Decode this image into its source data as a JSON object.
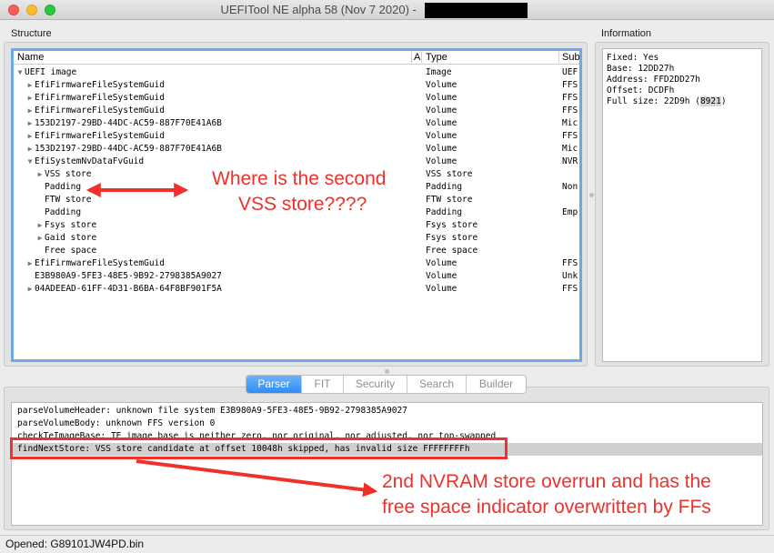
{
  "window": {
    "title": "UEFITool NE alpha 58 (Nov  7 2020) - "
  },
  "structure": {
    "label": "Structure",
    "columns": {
      "name": "Name",
      "action": "A",
      "type": "Type",
      "subtype": "Sub"
    },
    "rows": [
      {
        "name": "UEFI image",
        "type": "Image",
        "subtype": "UEF",
        "arrow": "▼"
      },
      {
        "name": "EfiFirmwareFileSystemGuid",
        "type": "Volume",
        "subtype": "FFS",
        "arrow": "▶"
      },
      {
        "name": "EfiFirmwareFileSystemGuid",
        "type": "Volume",
        "subtype": "FFS",
        "arrow": "▶"
      },
      {
        "name": "EfiFirmwareFileSystemGuid",
        "type": "Volume",
        "subtype": "FFS",
        "arrow": "▶"
      },
      {
        "name": "153D2197-29BD-44DC-AC59-887F70E41A6B",
        "type": "Volume",
        "subtype": "Mic",
        "arrow": "▶"
      },
      {
        "name": "EfiFirmwareFileSystemGuid",
        "type": "Volume",
        "subtype": "FFS",
        "arrow": "▶"
      },
      {
        "name": "153D2197-29BD-44DC-AC59-887F70E41A6B",
        "type": "Volume",
        "subtype": "Mic",
        "arrow": "▶"
      },
      {
        "name": "EfiSystemNvDataFvGuid",
        "type": "Volume",
        "subtype": "NVR",
        "arrow": "▼"
      },
      {
        "name": "VSS store",
        "type": "VSS store",
        "subtype": "",
        "arrow": "▶"
      },
      {
        "name": "Padding",
        "type": "Padding",
        "subtype": "Non",
        "arrow": ""
      },
      {
        "name": "FTW store",
        "type": "FTW store",
        "subtype": "",
        "arrow": ""
      },
      {
        "name": "Padding",
        "type": "Padding",
        "subtype": "Emp",
        "arrow": ""
      },
      {
        "name": "Fsys store",
        "type": "Fsys store",
        "subtype": "",
        "arrow": "▶"
      },
      {
        "name": "Gaid store",
        "type": "Fsys store",
        "subtype": "",
        "arrow": "▶"
      },
      {
        "name": "Free space",
        "type": "Free space",
        "subtype": "",
        "arrow": ""
      },
      {
        "name": "EfiFirmwareFileSystemGuid",
        "type": "Volume",
        "subtype": "FFS",
        "arrow": "▶"
      },
      {
        "name": "E3B980A9-5FE3-48E5-9B92-2798385A9027",
        "type": "Volume",
        "subtype": "Unk",
        "arrow": ""
      },
      {
        "name": "04ADEEAD-61FF-4D31-B6BA-64F8BF901F5A",
        "type": "Volume",
        "subtype": "FFS",
        "arrow": "▶"
      }
    ]
  },
  "information": {
    "label": "Information",
    "fixed": "Fixed: Yes",
    "base": "Base: 12DD27h",
    "address": "Address: FFD2DD27h",
    "offset": "Offset: DCDFh",
    "full_size_prefix": "Full size: 22D9h (",
    "full_size_dec": "8921",
    "full_size_suffix": ")"
  },
  "tabs": [
    "Parser",
    "FIT",
    "Security",
    "Search",
    "Builder"
  ],
  "messages": [
    "parseVolumeHeader: unknown file system E3B980A9-5FE3-48E5-9B92-2798385A9027",
    "parseVolumeBody: unknown FFS version 0",
    "checkTeImageBase: TE image base is neither zero, nor original, nor adjusted, nor top-swapped",
    "findNextStore: VSS store candidate at offset 10048h skipped, has invalid size FFFFFFFFh"
  ],
  "status": "Opened: G89101JW4PD.bin",
  "annotations": {
    "top_line1": "Where is the second",
    "top_line2": "VSS store????",
    "bottom_line1": "2nd NVRAM store overrun and has the",
    "bottom_line2": "free space indicator overwritten by FFs"
  },
  "colors": {
    "annotation": "#f0302a",
    "focus": "#6fa8e8",
    "tab_active": "#2f8cf5"
  }
}
